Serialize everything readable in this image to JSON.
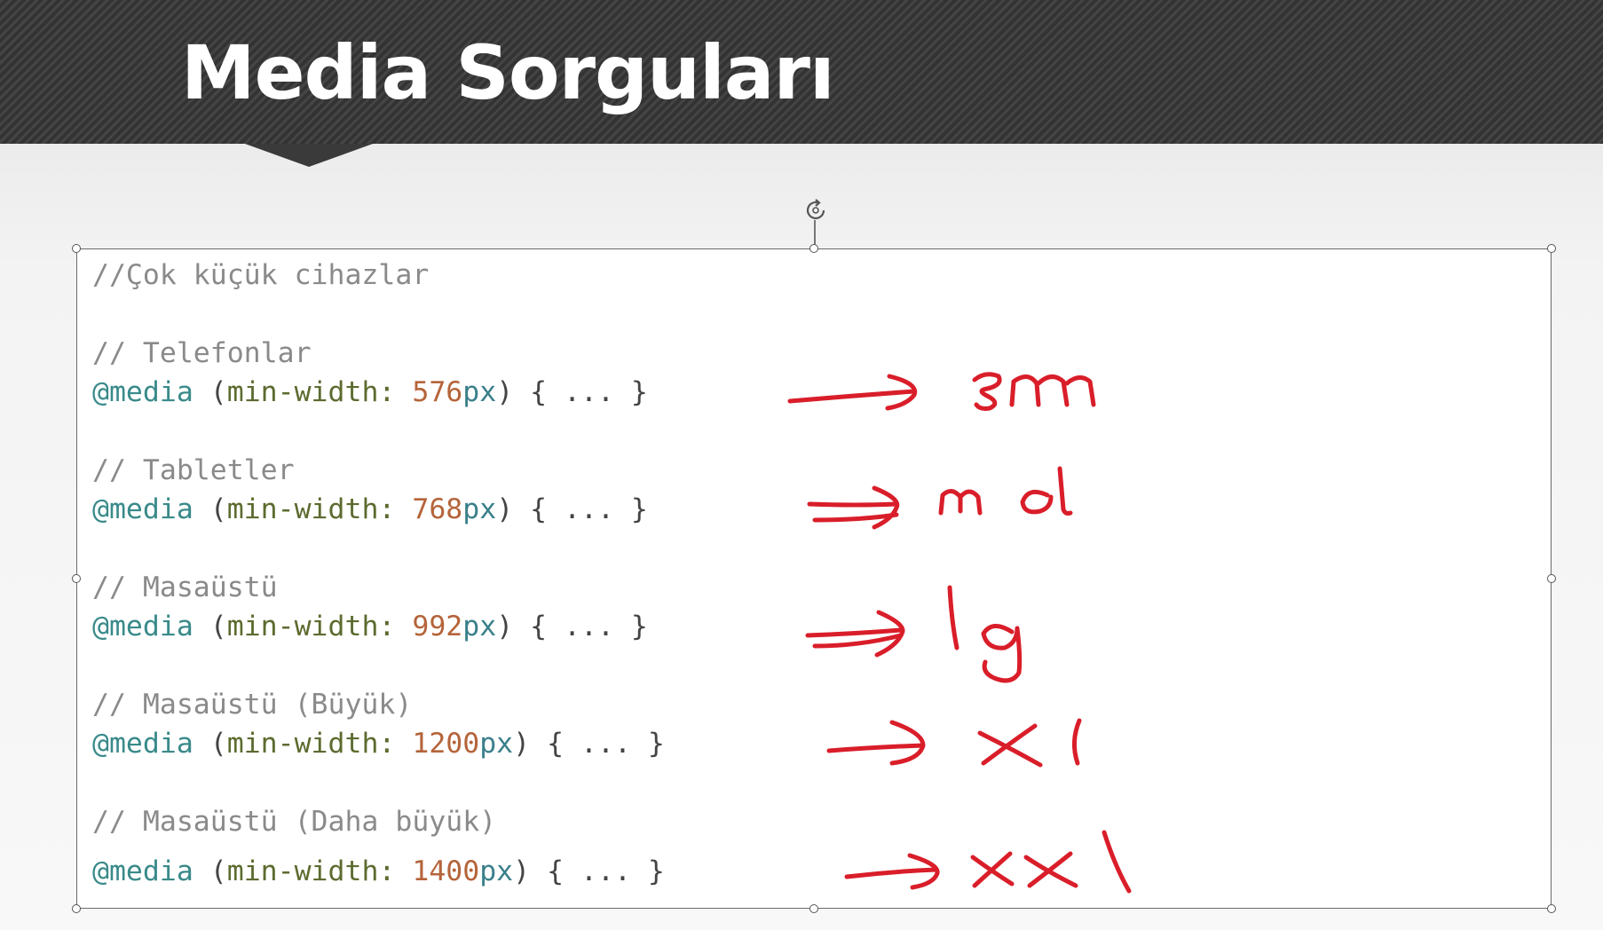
{
  "slide": {
    "title": "Media Sorguları"
  },
  "code": {
    "intro_comment": "//Çok küçük cihazlar",
    "rules": [
      {
        "comment": "// Telefonlar",
        "at": "@media",
        "open": "(",
        "prop": "min-width:",
        "value": "576",
        "unit": "px",
        "close": ")",
        "body": "{ ... }"
      },
      {
        "comment": "// Tabletler",
        "at": "@media",
        "open": "(",
        "prop": "min-width:",
        "value": "768",
        "unit": "px",
        "close": ")",
        "body": "{ ... }"
      },
      {
        "comment": "// Masaüstü",
        "at": "@media",
        "open": "(",
        "prop": "min-width:",
        "value": "992",
        "unit": "px",
        "close": ")",
        "body": "{ ... }"
      },
      {
        "comment": "// Masaüstü (Büyük)",
        "at": "@media",
        "open": "(",
        "prop": "min-width:",
        "value": "1200",
        "unit": "px",
        "close": ")",
        "body": "{ ... }"
      },
      {
        "comment": "// Masaüstü (Daha büyük)",
        "at": "@media",
        "open": "(",
        "prop": "min-width:",
        "value": "1400",
        "unit": "px",
        "close": ")",
        "body": "{ ... }"
      }
    ]
  },
  "annotations": {
    "color": "#d91e2a",
    "labels": [
      "sm",
      "md",
      "lg",
      "xl",
      "xxl"
    ]
  },
  "icons": {
    "rotate": "rotate-handle-icon",
    "resize": "resize-handle-icon"
  }
}
